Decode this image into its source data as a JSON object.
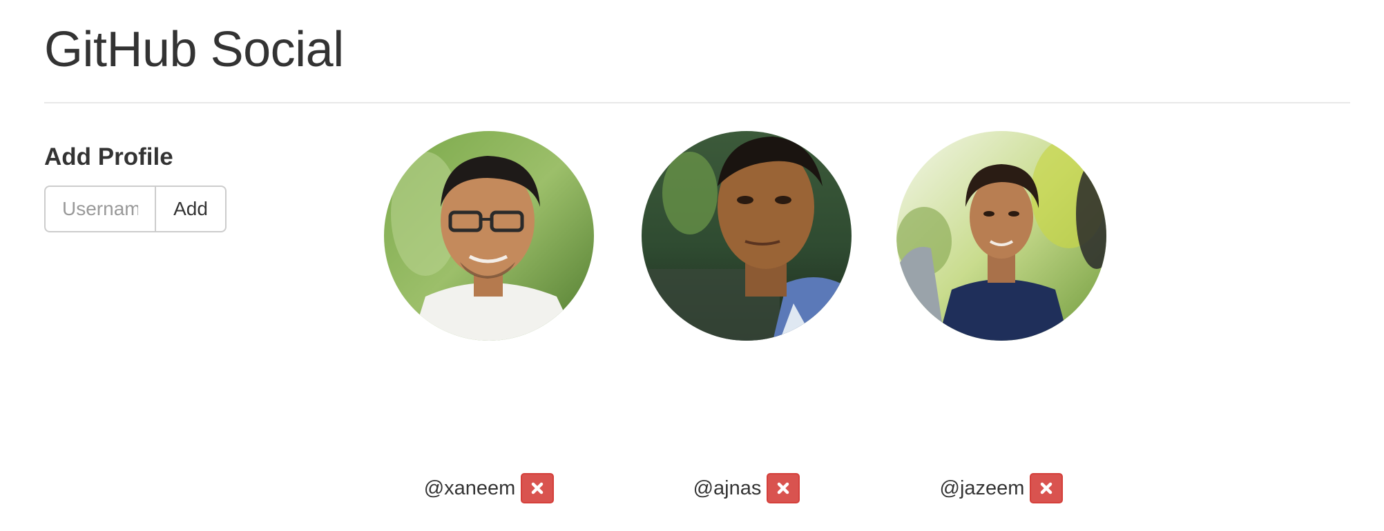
{
  "header": {
    "title": "GitHub Social"
  },
  "add_profile": {
    "title": "Add Profile",
    "username_value": "",
    "username_placeholder": "Username",
    "add_label": "Add"
  },
  "profiles": [
    {
      "handle": "@xaneem",
      "remove_icon": "times-icon"
    },
    {
      "handle": "@ajnas",
      "remove_icon": "times-icon"
    },
    {
      "handle": "@jazeem",
      "remove_icon": "times-icon"
    }
  ],
  "colors": {
    "text": "#333333",
    "danger": "#d9534f",
    "border": "#cccccc",
    "divider": "#e8e8e8"
  }
}
